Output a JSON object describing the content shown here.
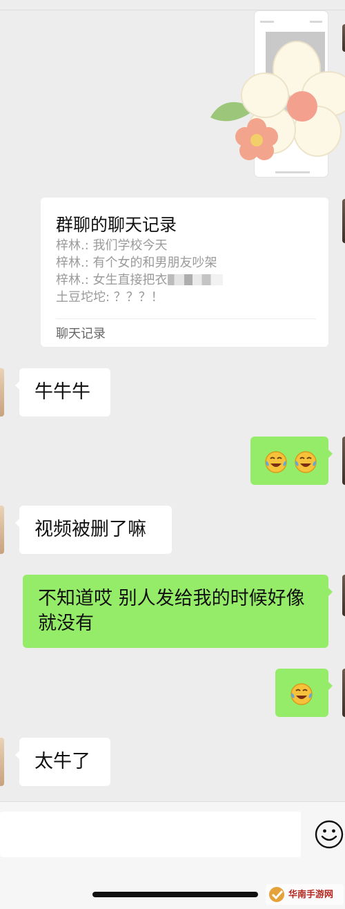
{
  "chat_record": {
    "title": "群聊的聊天记录",
    "lines": [
      "梓林.: 我们学校今天",
      "梓林.: 有个女的和男朋友吵架",
      "梓林.: 女生直接把衣",
      "土豆坨坨: ？？？！"
    ],
    "footer": "聊天记录"
  },
  "messages": [
    {
      "side": "left",
      "text": "牛牛牛"
    },
    {
      "side": "right",
      "emoji": [
        "face-with-tears-of-joy",
        "face-with-tears-of-joy"
      ]
    },
    {
      "side": "left",
      "text": "视频被删了嘛"
    },
    {
      "side": "right",
      "text": "不知道哎 别人发给我的时候好像就没有"
    },
    {
      "side": "right",
      "emoji": [
        "face-with-tears-of-joy"
      ]
    },
    {
      "side": "left",
      "text": "太牛了"
    }
  ],
  "colors": {
    "sent_bubble": "#95ec69",
    "received_bubble": "#ffffff",
    "background": "#ededed"
  },
  "watermark": {
    "text": "华南手游网"
  }
}
